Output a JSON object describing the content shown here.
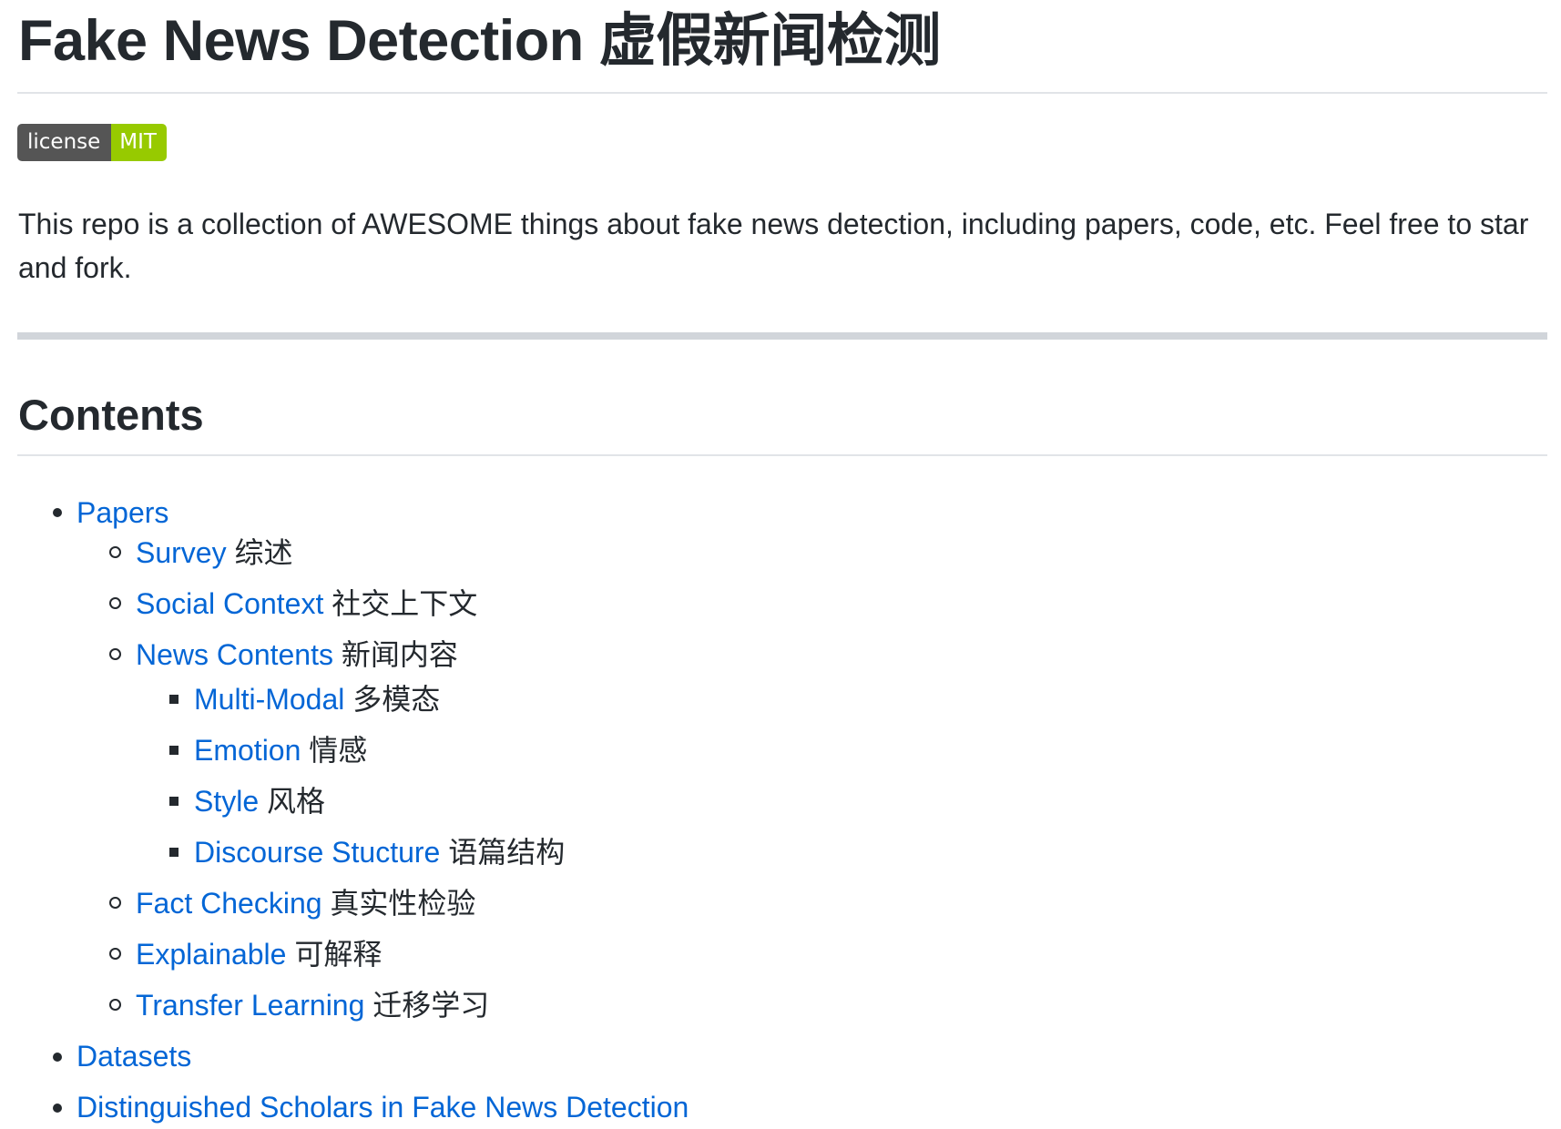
{
  "page": {
    "title": "Fake News Detection 虚假新闻检测",
    "badge": {
      "label": "license",
      "value": "MIT",
      "label_color": "#555555",
      "value_color": "#97ca00"
    },
    "intro": "This repo is a collection of AWESOME things about fake news detection, including papers, code, etc. Feel free to star and fork.",
    "contents_heading": "Contents"
  },
  "toc": {
    "papers": {
      "link": "Papers"
    },
    "survey": {
      "link": "Survey",
      "zh": "综述"
    },
    "social_context": {
      "link": "Social Context",
      "zh": "社交上下文"
    },
    "news_contents": {
      "link": "News Contents",
      "zh": "新闻内容"
    },
    "multi_modal": {
      "link": "Multi-Modal",
      "zh": "多模态"
    },
    "emotion": {
      "link": "Emotion",
      "zh": "情感"
    },
    "style": {
      "link": "Style",
      "zh": "风格"
    },
    "discourse": {
      "link": "Discourse Stucture",
      "zh": "语篇结构"
    },
    "fact_checking": {
      "link": "Fact Checking",
      "zh": "真实性检验"
    },
    "explainable": {
      "link": "Explainable",
      "zh": "可解释"
    },
    "transfer_learning": {
      "link": "Transfer Learning",
      "zh": "迁移学习"
    },
    "datasets": {
      "link": "Datasets"
    },
    "scholars": {
      "link": "Distinguished Scholars in Fake News Detection"
    }
  },
  "colors": {
    "link": "#0366d6",
    "text": "#24292e",
    "rule": "#e1e4e8"
  }
}
